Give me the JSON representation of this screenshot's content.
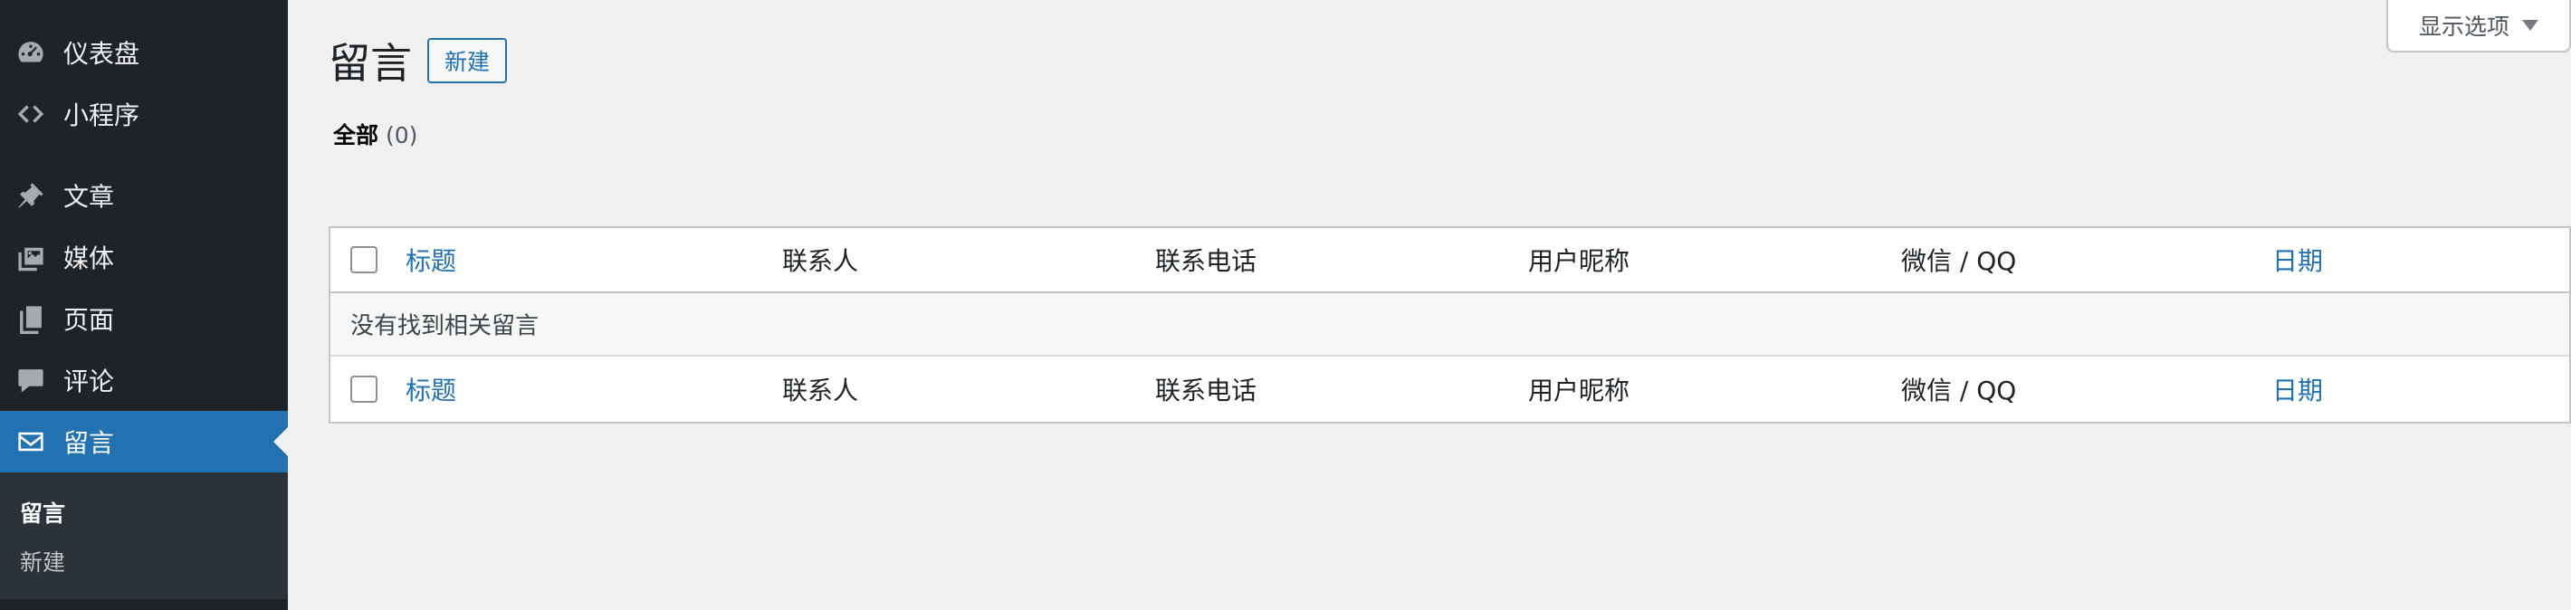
{
  "sidebar": {
    "items": [
      {
        "label": "仪表盘",
        "icon": "dashboard-icon"
      },
      {
        "label": "小程序",
        "icon": "code-icon"
      },
      {
        "label": "文章",
        "icon": "pin-icon"
      },
      {
        "label": "媒体",
        "icon": "media-icon"
      },
      {
        "label": "页面",
        "icon": "pages-icon"
      },
      {
        "label": "评论",
        "icon": "comment-icon"
      },
      {
        "label": "留言",
        "icon": "mail-icon",
        "active": true
      }
    ],
    "submenu": [
      {
        "label": "留言",
        "current": true
      },
      {
        "label": "新建"
      }
    ]
  },
  "screen_options": {
    "label": "显示选项"
  },
  "header": {
    "title": "留言",
    "add_new": "新建"
  },
  "filters": {
    "all_label": "全部",
    "all_count": "(0)"
  },
  "table": {
    "columns": [
      "标题",
      "联系人",
      "联系电话",
      "用户昵称",
      "微信 / QQ",
      "日期"
    ],
    "empty_message": "没有找到相关留言"
  },
  "colors": {
    "accent": "#2271b1",
    "sidebar_bg": "#1d2327",
    "page_bg": "#f0f0f1"
  }
}
